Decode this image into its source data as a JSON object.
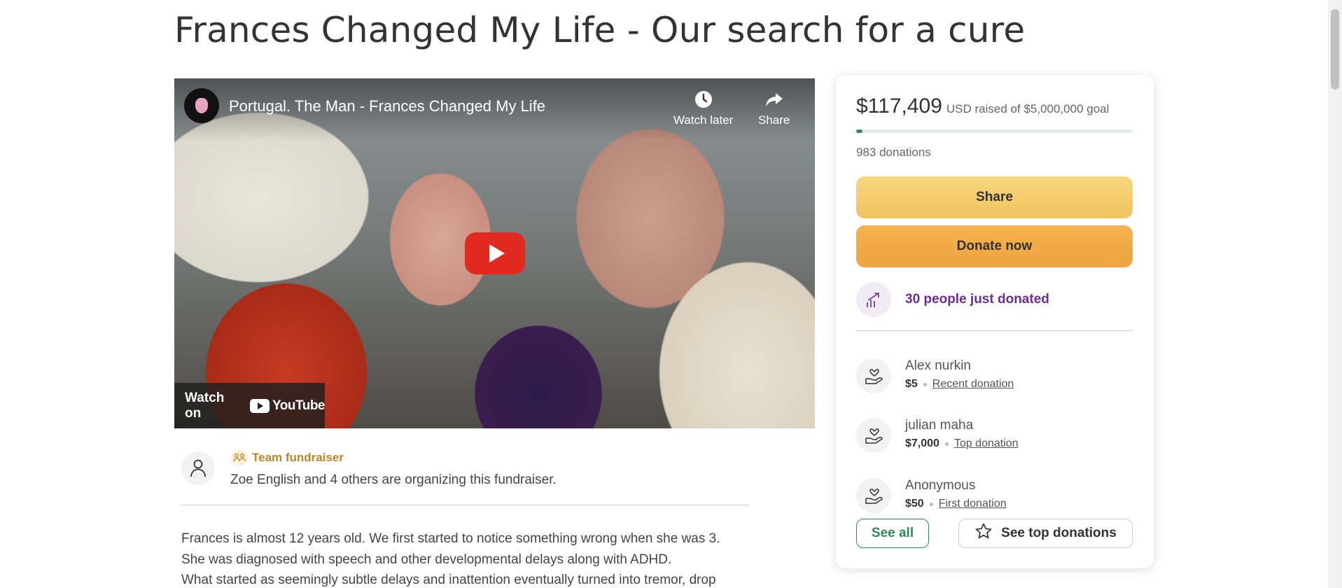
{
  "page": {
    "title": "Frances Changed My Life - Our search for a cure"
  },
  "video": {
    "title": "Portugal. The Man - Frances Changed My Life",
    "watch_later_label": "Watch later",
    "share_label": "Share",
    "watch_on_label": "Watch on",
    "youtube_label": "YouTube"
  },
  "organizer": {
    "badge_label": "Team fundraiser",
    "text": "Zoe English and 4 others are organizing this fundraiser."
  },
  "story": {
    "lines": [
      "Frances is almost 12 years old. We first started to notice something wrong when she was 3.",
      "She was diagnosed with speech and other developmental delays along with ADHD.",
      "What started as seemingly subtle delays and inattention eventually turned into tremor, drop"
    ]
  },
  "card": {
    "amount": "$117,409",
    "goal_text": "USD raised of $5,000,000 goal",
    "progress_fraction": 0.0235,
    "donation_count": "983 donations",
    "share_button": "Share",
    "donate_button": "Donate now",
    "trend_text": "30 people just donated",
    "donors": [
      {
        "name": "Alex nurkin",
        "amount": "$5",
        "tag": "Recent donation"
      },
      {
        "name": "julian maha",
        "amount": "$7,000",
        "tag": "Top donation"
      },
      {
        "name": "Anonymous",
        "amount": "$50",
        "tag": "First donation"
      }
    ],
    "see_all_button": "See all",
    "see_top_button": "See top donations"
  },
  "colors": {
    "accent_green": "#2f8a5b",
    "share_yellow": "#f0c35e",
    "donate_orange": "#eda441",
    "trend_purple": "#6c2d8d",
    "team_gold": "#b9862b",
    "youtube_red": "#e02a20"
  },
  "icons": {
    "channel": "channel-avatar-icon",
    "watch_later": "clock-icon",
    "share": "share-arrow-icon",
    "play": "play-icon",
    "organizer": "user-icon",
    "team": "team-icon",
    "trend": "trending-up-icon",
    "donor": "donation-hand-icon",
    "star": "star-icon"
  }
}
